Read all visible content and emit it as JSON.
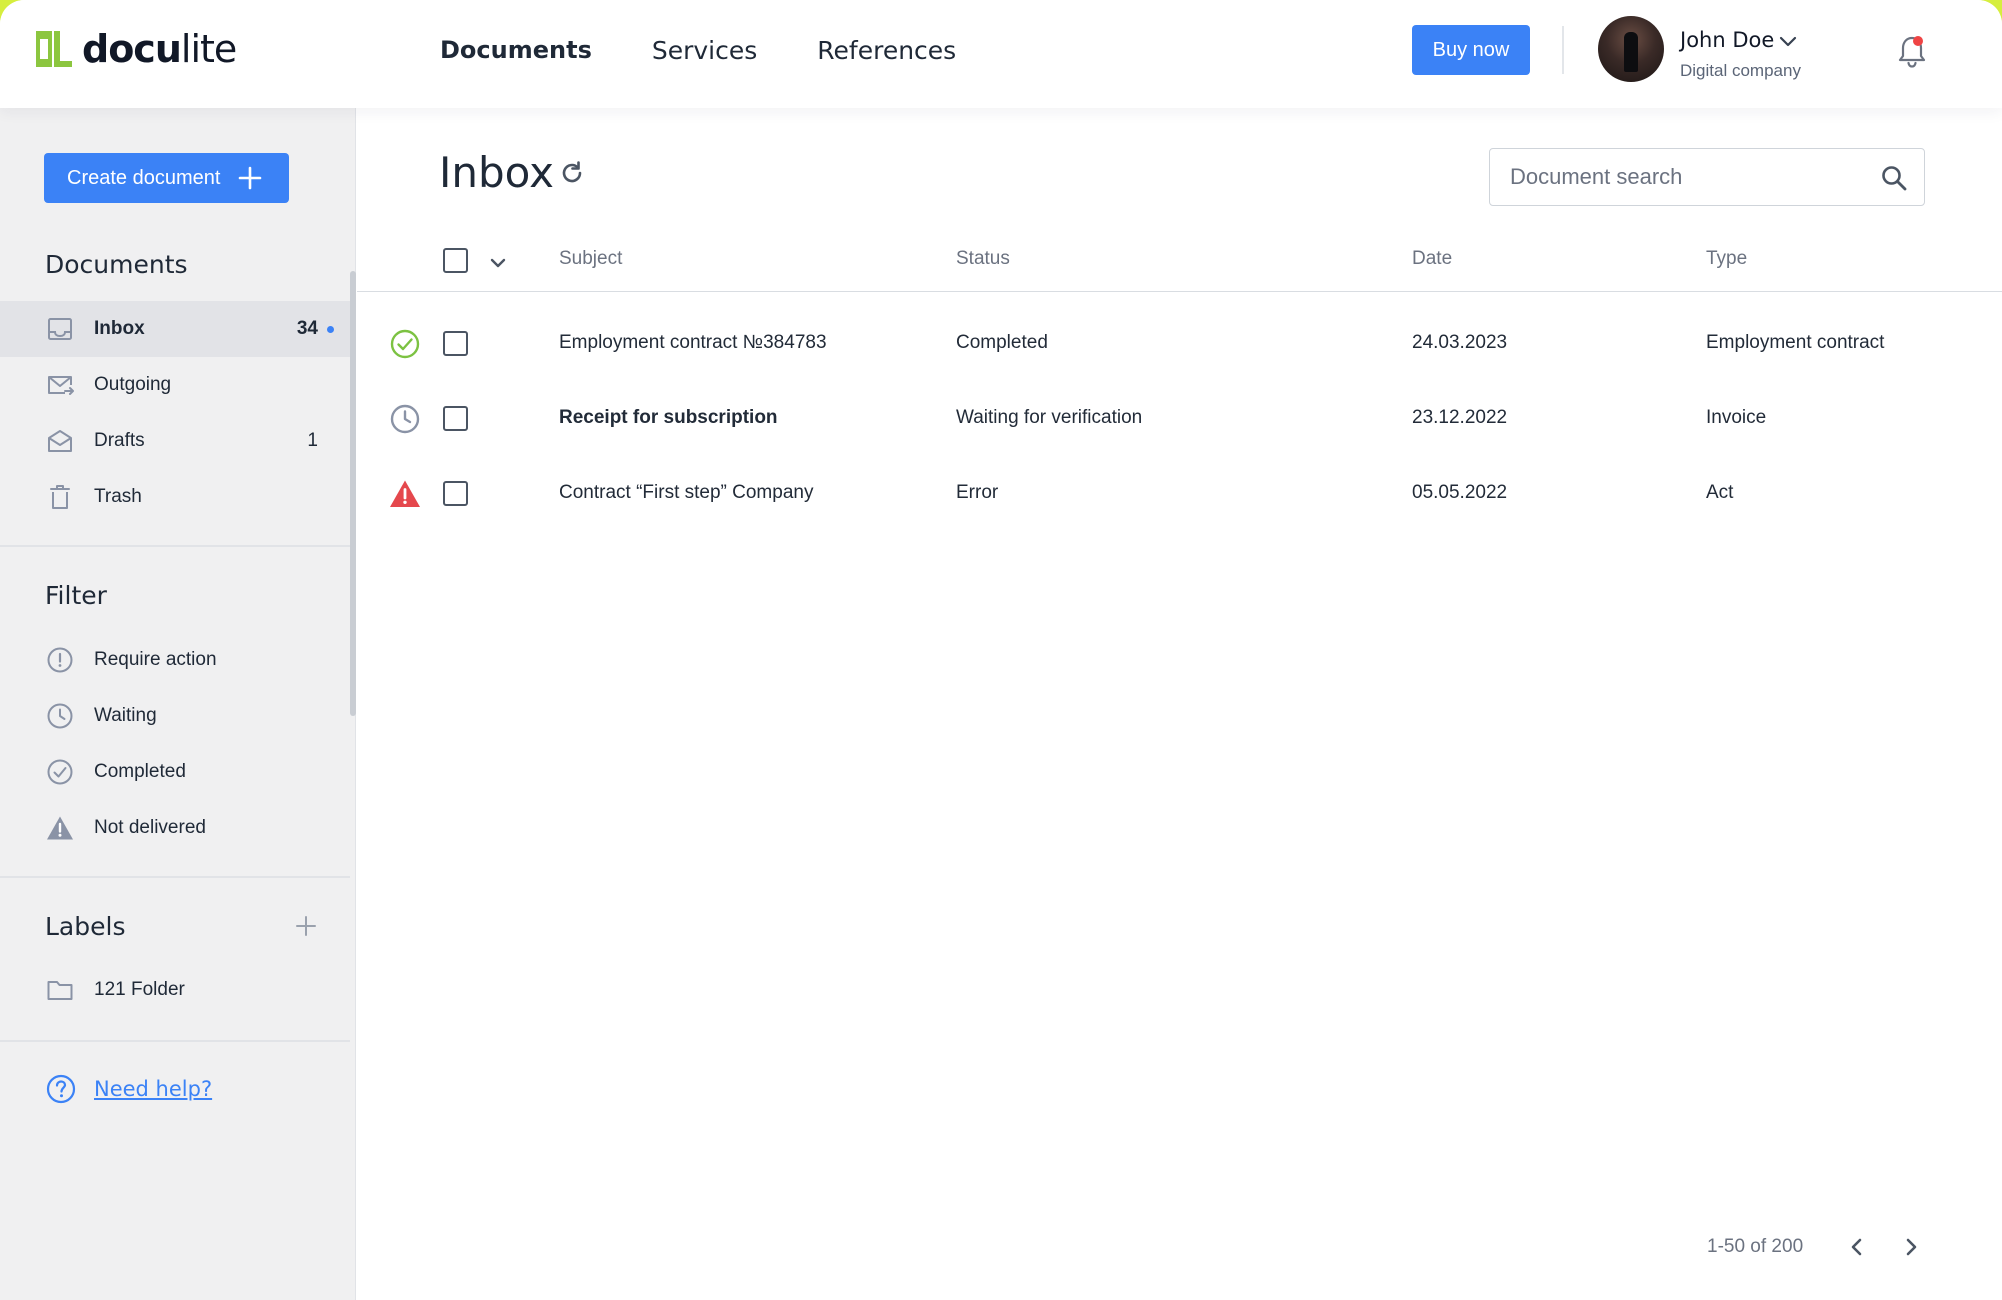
{
  "header": {
    "logo_text_a": "docu",
    "logo_text_b": "lite",
    "nav": [
      "Documents",
      "Services",
      "References"
    ],
    "buy_label": "Buy now",
    "user_name": "John Doe",
    "user_company": "Digital company",
    "accent": "#3b82f6",
    "brand_green": "#8cc63f"
  },
  "sidebar": {
    "create_label": "Create document",
    "documents_title": "Documents",
    "folders": [
      {
        "label": "Inbox",
        "count": "34",
        "icon": "inbox-icon",
        "active": true,
        "unread": true
      },
      {
        "label": "Outgoing",
        "count": "",
        "icon": "outgoing-mail-icon"
      },
      {
        "label": "Drafts",
        "count": "1",
        "icon": "drafts-icon"
      },
      {
        "label": "Trash",
        "count": "",
        "icon": "trash-icon"
      }
    ],
    "filter_title": "Filter",
    "filters": [
      {
        "label": "Require action",
        "icon": "exclamation-circle-icon"
      },
      {
        "label": "Waiting",
        "icon": "clock-icon"
      },
      {
        "label": "Completed",
        "icon": "check-circle-icon"
      },
      {
        "label": "Not delivered",
        "icon": "warning-triangle-icon"
      }
    ],
    "labels_title": "Labels",
    "labels": [
      {
        "label": "121 Folder",
        "icon": "folder-icon"
      }
    ],
    "help_label": "Need help?"
  },
  "main": {
    "title": "Inbox",
    "search_placeholder": "Document search",
    "columns": {
      "subject": "Subject",
      "status": "Status",
      "date": "Date",
      "type": "Type"
    },
    "rows": [
      {
        "subject": "Employment contract №384783",
        "status": "Completed",
        "date": "24.03.2023",
        "type": "Employment contract",
        "state": "completed",
        "bold": false
      },
      {
        "subject": "Receipt for subscription",
        "status": "Waiting for verification",
        "date": "23.12.2022",
        "type": "Invoice",
        "state": "waiting",
        "bold": true
      },
      {
        "subject": "Contract “First step” Company",
        "status": "Error",
        "date": "05.05.2022",
        "type": "Act",
        "state": "error",
        "bold": false
      }
    ],
    "pagination": "1-50 of 200",
    "status_colors": {
      "completed": "#7cc242",
      "waiting": "#8a93a6",
      "error": "#e5484d"
    }
  }
}
